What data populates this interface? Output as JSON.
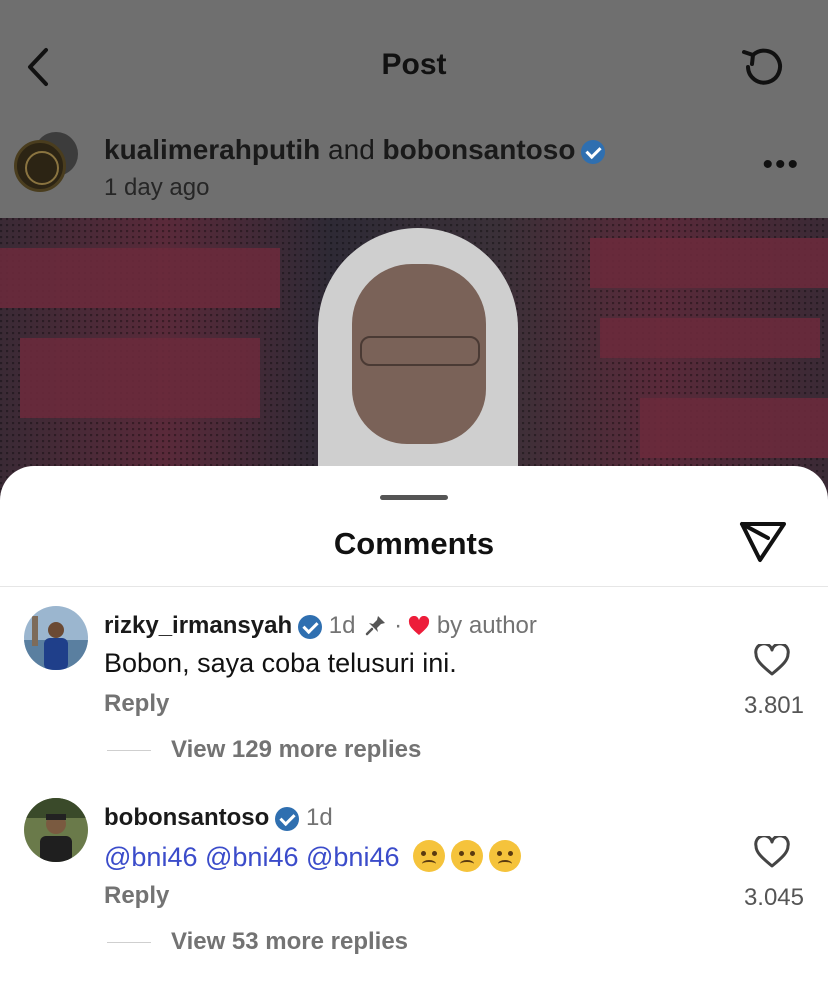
{
  "header": {
    "title": "Post",
    "back_icon": "back-arrow-icon",
    "refresh_icon": "refresh-icon"
  },
  "post": {
    "author_primary": "kualimerahputih",
    "author_joiner": "and",
    "author_secondary": "bobonsantoso",
    "time": "1 day ago",
    "more_icon": "more-horizontal-icon"
  },
  "comments_sheet": {
    "title": "Comments",
    "share_icon": "send-icon",
    "items": [
      {
        "username": "rizky_irmansyah",
        "time": "1d",
        "dot": "·",
        "liked_by": "by author",
        "text": "Bobon, saya coba telusuri ini.",
        "reply_label": "Reply",
        "likes": "3.801",
        "view_more": "View 129 more replies"
      },
      {
        "username": "bobonsantoso",
        "time": "1d",
        "mentions": [
          "@bni46",
          "@bni46",
          "@bni46"
        ],
        "reply_label": "Reply",
        "likes": "3.045",
        "view_more": "View 53 more replies"
      }
    ]
  },
  "colors": {
    "verified": "#3897f0",
    "mention": "#3b4cca",
    "heart": "#ed4956",
    "overlay": "#6f6f6f"
  }
}
